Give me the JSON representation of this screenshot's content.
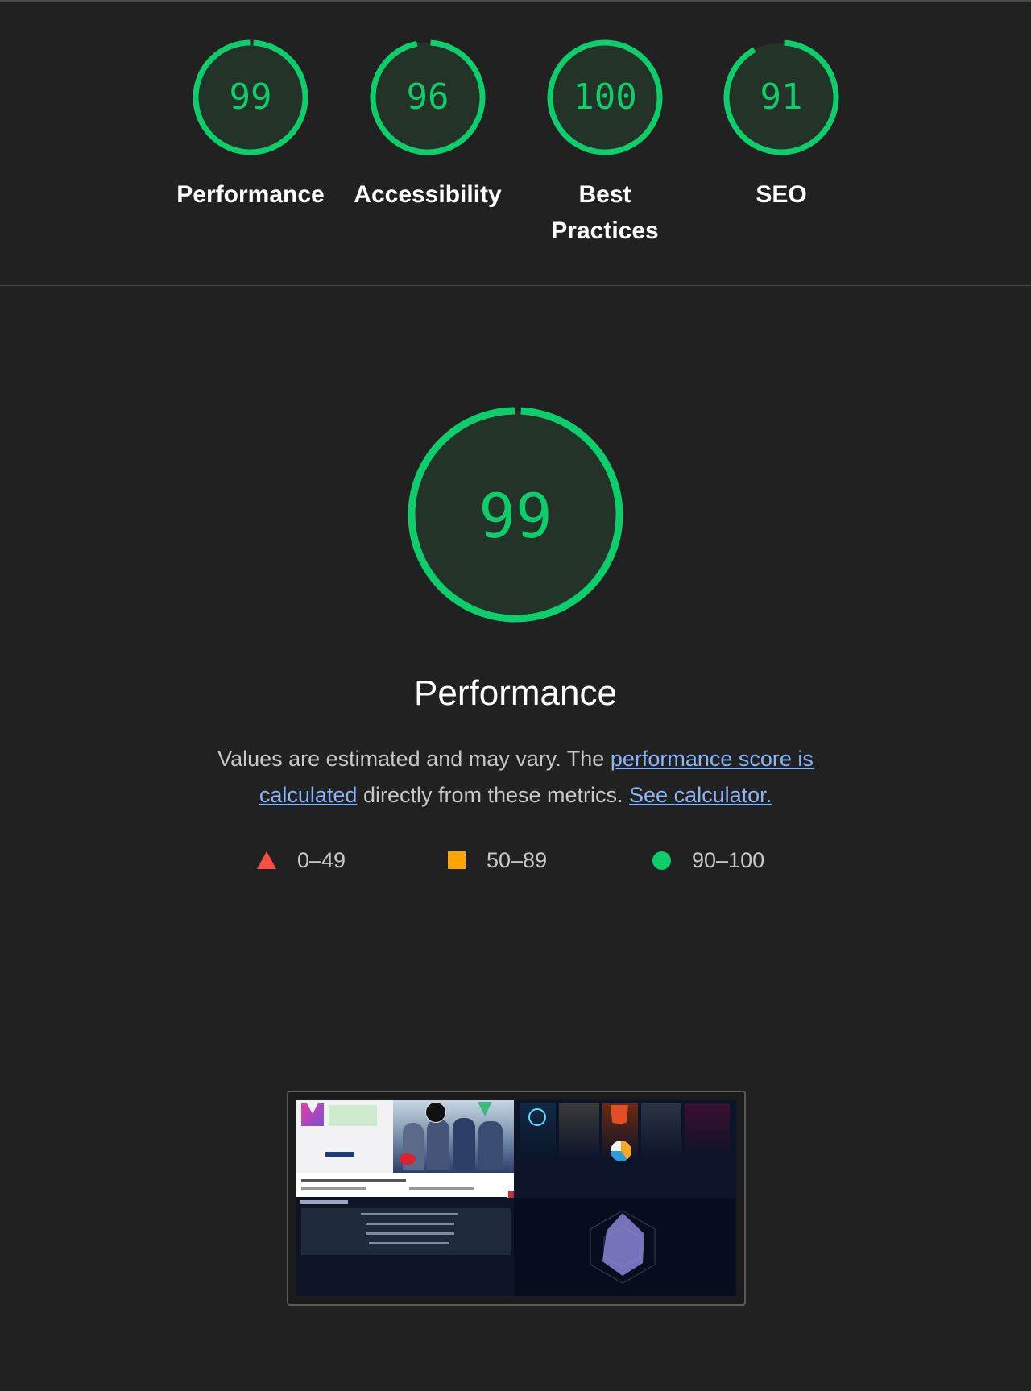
{
  "colors": {
    "pass": "#0cce6b",
    "pass_fill": "#243328",
    "average": "#ffa400",
    "fail": "#ff4e42",
    "link": "#8ab4f8",
    "background": "#212121"
  },
  "summary": {
    "gauges": [
      {
        "score": 99,
        "label": "Performance"
      },
      {
        "score": 96,
        "label": "Accessibility"
      },
      {
        "score": 100,
        "label": "Best Practices"
      },
      {
        "score": 91,
        "label": "SEO"
      }
    ]
  },
  "performance": {
    "score": 99,
    "title": "Performance",
    "desc_prefix": "Values are estimated and may vary. The ",
    "desc_link1": "performance score is calculated",
    "desc_middle": " directly from these metrics. ",
    "desc_link2": "See calculator."
  },
  "legend": [
    {
      "icon": "triangle-icon",
      "range": "0–49"
    },
    {
      "icon": "square-icon",
      "range": "50–89"
    },
    {
      "icon": "circle-icon",
      "range": "90–100"
    }
  ],
  "thumbnail": {
    "icon": "page-screenshot-thumbnail"
  }
}
